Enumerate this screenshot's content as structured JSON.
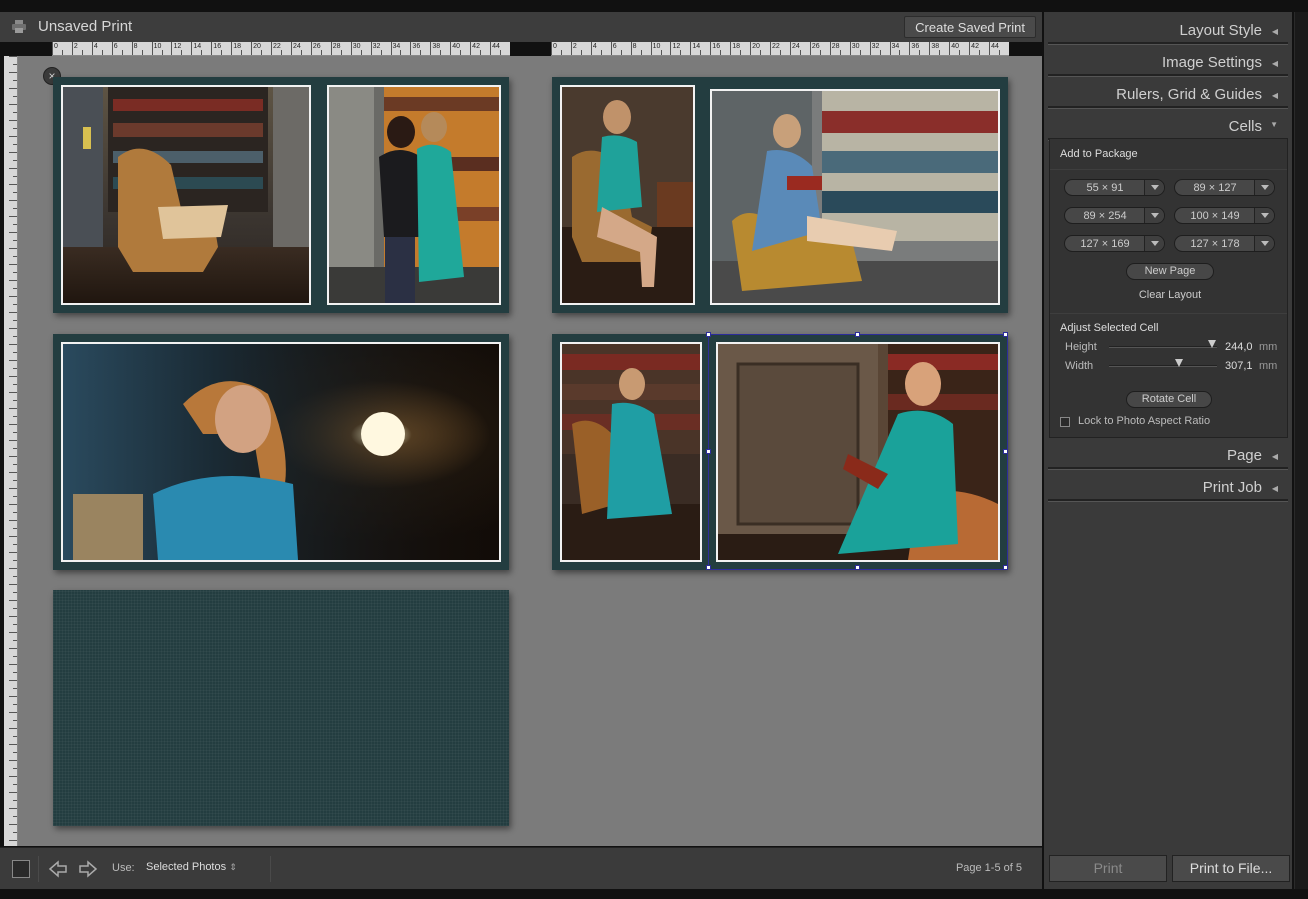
{
  "header": {
    "title": "Unsaved Print",
    "create_saved_print": "Create Saved Print"
  },
  "rulers": {
    "top_left": [
      "0",
      "2",
      "4",
      "6",
      "8",
      "10",
      "12",
      "14",
      "16",
      "18",
      "20",
      "22",
      "24",
      "26",
      "28",
      "30",
      "32",
      "34",
      "36",
      "38",
      "40",
      "42",
      "44"
    ],
    "top_right": [
      "0",
      "2",
      "4",
      "6",
      "8",
      "10",
      "12",
      "14",
      "16",
      "18",
      "20",
      "22",
      "24",
      "26",
      "28",
      "30",
      "32",
      "34",
      "36",
      "38",
      "40",
      "42",
      "44"
    ]
  },
  "right_panel": {
    "layout_style": "Layout Style",
    "image_settings": "Image Settings",
    "rulers_grid_guides": "Rulers, Grid & Guides",
    "cells": "Cells",
    "add_to_package": "Add to Package",
    "sizes": [
      "55 × 91",
      "89 × 127",
      "89 × 254",
      "100 × 149",
      "127 × 169",
      "127 × 178"
    ],
    "new_page": "New Page",
    "clear_layout": "Clear Layout",
    "adjust_selected_cell": "Adjust Selected Cell",
    "height_label": "Height",
    "height_value": "244,0",
    "width_label": "Width",
    "width_value": "307,1",
    "unit": "mm",
    "height_fraction": 0.95,
    "width_fraction": 0.65,
    "rotate_cell": "Rotate Cell",
    "lock_aspect": "Lock to Photo Aspect Ratio",
    "page": "Page",
    "print_job": "Print Job",
    "print": "Print",
    "print_to_file": "Print to File..."
  },
  "toolbar": {
    "use_label": "Use:",
    "use_value": "Selected Photos",
    "page_info": "Page 1-5 of 5"
  },
  "icons": {
    "printer": "printer-icon",
    "close": "close-icon",
    "prev": "arrow-left-icon",
    "next": "arrow-right-icon",
    "collapse": "triangle-left-icon",
    "expand": "triangle-down-icon"
  }
}
